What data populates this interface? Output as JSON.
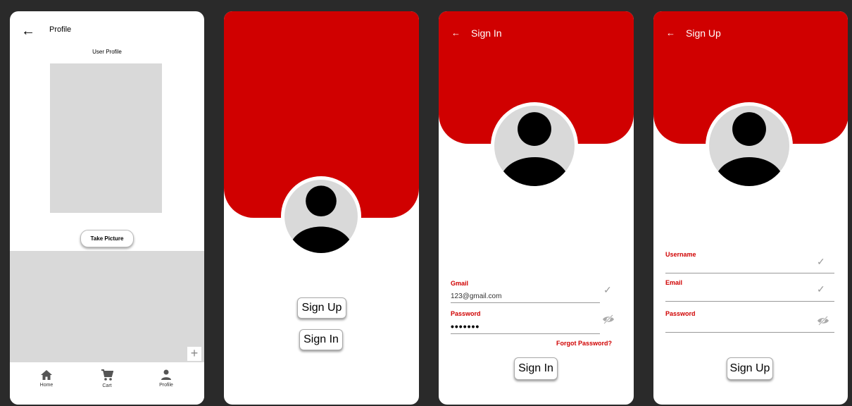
{
  "profile_screen": {
    "back_icon": "arrow-left-icon",
    "title": "Profile",
    "subtitle": "User Profile",
    "take_picture_label": "Take Picture",
    "add_icon": "plus-icon",
    "nav": [
      {
        "label": "Home",
        "icon": "home-icon"
      },
      {
        "label": "Cart",
        "icon": "cart-icon"
      },
      {
        "label": "Profile",
        "icon": "person-icon"
      }
    ]
  },
  "welcome_screen": {
    "avatar_icon": "user-avatar-icon",
    "signup_label": "Sign Up",
    "signin_label": "Sign In"
  },
  "signin_screen": {
    "back_icon": "arrow-left-icon",
    "title": "Sign In",
    "gmail_label": "Gmail",
    "gmail_value": "123@gmail.com",
    "password_label": "Password",
    "password_value": "•••••••",
    "check_icon": "check-icon",
    "hide_icon": "eye-off-icon",
    "forgot_label": "Forgot Password?",
    "submit_label": "Sign In"
  },
  "signup_screen": {
    "back_icon": "arrow-left-icon",
    "title": "Sign Up",
    "username_label": "Username",
    "email_label": "Email",
    "password_label": "Password",
    "check_icon": "check-icon",
    "hide_icon": "eye-off-icon",
    "submit_label": "Sign Up"
  },
  "colors": {
    "accent": "#d00000",
    "placeholder_gray": "#d9d9d9",
    "background": "#2a2a2a"
  }
}
